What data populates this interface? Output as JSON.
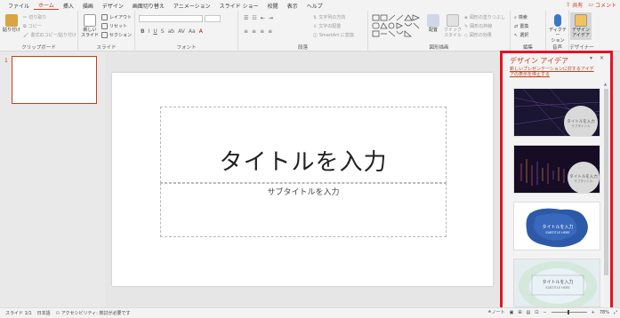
{
  "ribbon_tabs": [
    "ファイル",
    "ホーム",
    "挿入",
    "描画",
    "デザイン",
    "画面切り替え",
    "アニメーション",
    "スライド ショー",
    "校閲",
    "表示",
    "ヘルプ"
  ],
  "active_tab": "ホーム",
  "top_right": {
    "share": "共有",
    "comment": "コメント"
  },
  "ribbon": {
    "clipboard": {
      "paste": "貼り付け",
      "cut": "切り取り",
      "copy": "コピー",
      "format_painter": "書式のコピー/貼り付け",
      "label": "クリップボード"
    },
    "slides": {
      "new_slide": "新しい\nスライド",
      "layout": "レイアウト",
      "reset": "リセット",
      "section": "セクション",
      "label": "スライド"
    },
    "font": {
      "label": "フォント",
      "buttons": [
        "B",
        "I",
        "U",
        "S",
        "ab",
        "AV",
        "Aa",
        "A"
      ]
    },
    "paragraph": {
      "label": "段落",
      "text_direction": "文字列の方向",
      "align_text": "文字の配置",
      "smartart": "SmartArt に変換"
    },
    "drawing": {
      "arrange": "配置",
      "quick_styles": "クイック\nスタイル",
      "fill": "図形の塗りつぶし",
      "outline": "図形の枠線",
      "effects": "図形の効果",
      "label": "図形描画"
    },
    "editing": {
      "find": "検索",
      "replace": "置換",
      "select": "選択",
      "label": "編集"
    },
    "voice": {
      "dictate": "ディクテー\nション",
      "label": "音声"
    },
    "designer": {
      "design_ideas": "デザイン\nアイデア",
      "label": "デザイナー"
    }
  },
  "slide_panel": {
    "slide_number": "1"
  },
  "slide": {
    "title_placeholder": "タイトルを入力",
    "subtitle_placeholder": "サブタイトルを入力"
  },
  "design_pane": {
    "title": "デザイン アイデア",
    "link": "新しいプレゼンテーションに対するアイデアの表示を停止する",
    "cards": [
      {
        "title": "タイトルを入力",
        "subtitle": "サブタイトル"
      },
      {
        "title": "タイトルを入力",
        "subtitle": "サブタイトル"
      },
      {
        "title": "タイトルを入力",
        "subtitle": "SUBTITLE HERE"
      },
      {
        "title": "タイトルを入力",
        "subtitle": "SUBTITLE HERE"
      }
    ]
  },
  "status_bar": {
    "slide": "スライド 1/1",
    "language": "日本語",
    "accessibility": "アクセシビリティ: 検討が必要です",
    "notes": "ノート",
    "zoom": "78%"
  },
  "colors": {
    "accent": "#c43e1c",
    "highlight": "#e81123"
  }
}
